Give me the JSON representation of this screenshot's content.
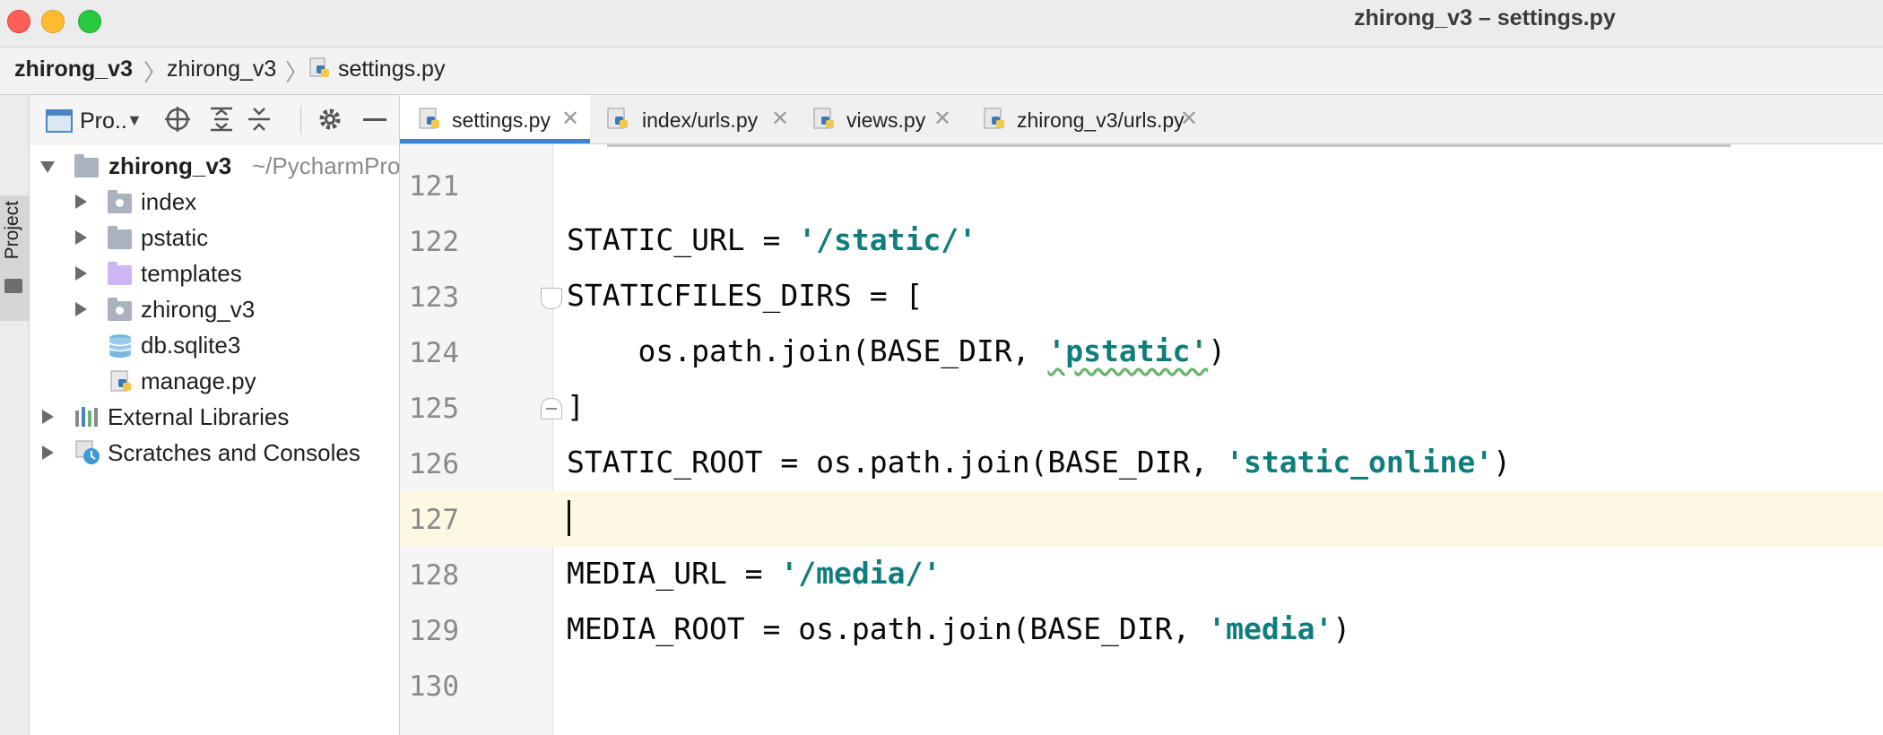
{
  "window": {
    "title": "zhirong_v3 – settings.py"
  },
  "breadcrumb": {
    "items": [
      "zhirong_v3",
      "zhirong_v3",
      "settings.py"
    ]
  },
  "tool_stripe": {
    "project_tab": "Project"
  },
  "project_panel": {
    "title": "Pro..",
    "root": {
      "name": "zhirong_v3",
      "path": "~/PycharmPro"
    },
    "children": [
      {
        "name": "index",
        "type": "package"
      },
      {
        "name": "pstatic",
        "type": "folder"
      },
      {
        "name": "templates",
        "type": "template-folder"
      },
      {
        "name": "zhirong_v3",
        "type": "package"
      },
      {
        "name": "db.sqlite3",
        "type": "database"
      },
      {
        "name": "manage.py",
        "type": "python"
      }
    ],
    "extras": [
      "External Libraries",
      "Scratches and Consoles"
    ]
  },
  "tabs": [
    {
      "label": "settings.py",
      "active": true
    },
    {
      "label": "index/urls.py",
      "active": false
    },
    {
      "label": "views.py",
      "active": false
    },
    {
      "label": "zhirong_v3/urls.py",
      "active": false
    }
  ],
  "editor": {
    "current_line": "127",
    "lines": [
      {
        "no": "121",
        "code": ""
      },
      {
        "no": "122",
        "pre": "STATIC_URL = ",
        "str": "'/static/'",
        "post": ""
      },
      {
        "no": "123",
        "pre": "STATICFILES_DIRS = [",
        "str": "",
        "post": ""
      },
      {
        "no": "124",
        "pre": "    os.path.join(BASE_DIR, ",
        "str": "'pstatic'",
        "post": ")"
      },
      {
        "no": "125",
        "pre": "]",
        "str": "",
        "post": ""
      },
      {
        "no": "126",
        "pre": "STATIC_ROOT = os.path.join(BASE_DIR, ",
        "str": "'static_online'",
        "post": ")"
      },
      {
        "no": "127",
        "pre": "",
        "str": "",
        "post": ""
      },
      {
        "no": "128",
        "pre": "MEDIA_URL = ",
        "str": "'/media/'",
        "post": ""
      },
      {
        "no": "129",
        "pre": "MEDIA_ROOT = os.path.join(BASE_DIR, ",
        "str": "'media'",
        "post": ")"
      },
      {
        "no": "130",
        "pre": "",
        "str": "",
        "post": ""
      }
    ]
  },
  "colors": {
    "accent_tab": "#4083c9",
    "string": "#107d7d",
    "current_line_bg": "#fdf8e4"
  }
}
